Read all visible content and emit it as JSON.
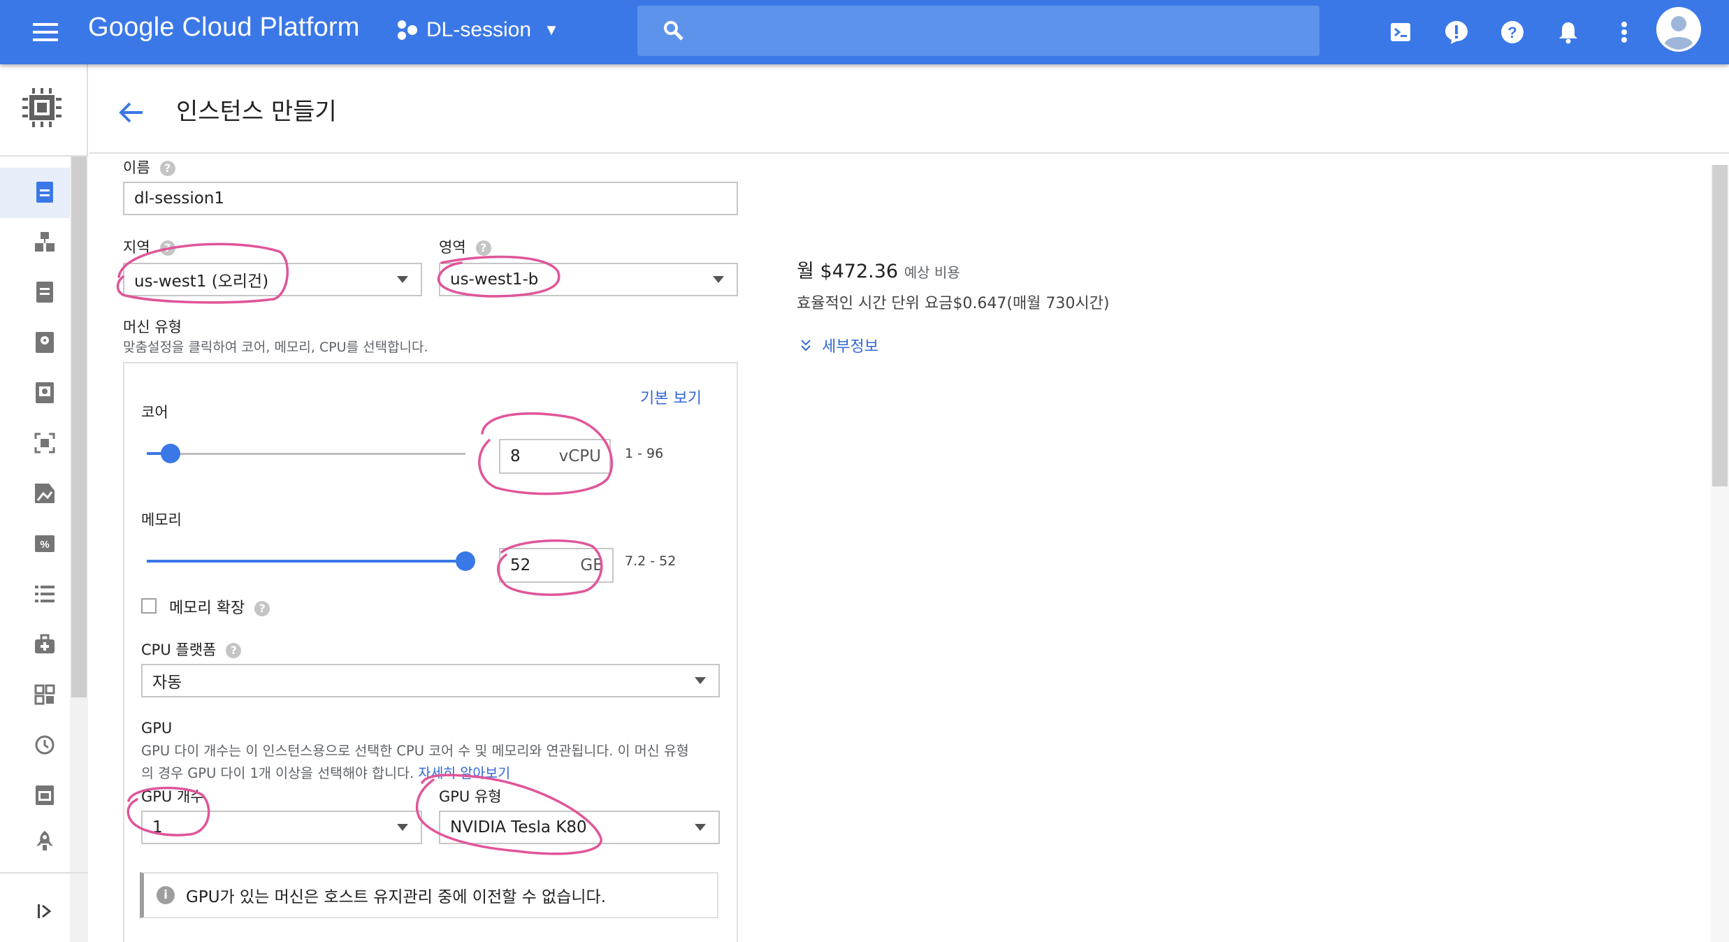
{
  "topbar": {
    "app_title": "Google Cloud Platform",
    "project_name": "DL-session",
    "icons": [
      "menu-icon",
      "search-icon",
      "cloud-shell-icon",
      "alert-icon",
      "help-icon",
      "notifications-icon",
      "more-vert-icon",
      "account-icon"
    ],
    "accent": "#3b78e7"
  },
  "rail": {
    "icons": [
      "compute-engine-icon",
      "vm-instances-icon",
      "instance-groups-icon",
      "instance-templates-icon",
      "disks-icon",
      "snapshots-icon",
      "images-icon",
      "tpus-icon",
      "committed-use-icon",
      "metadata-icon",
      "health-checks-icon",
      "zones-icon",
      "operations-icon",
      "security-scans-icon",
      "marketplace-icon",
      "collapse-icon"
    ]
  },
  "header": {
    "title": "인스턴스 만들기"
  },
  "form": {
    "name_label": "이름",
    "name_value": "dl-session1",
    "region_label": "지역",
    "region_value": "us-west1 (오리건)",
    "zone_label": "영역",
    "zone_value": "us-west1-b",
    "machine_type_label": "머신 유형",
    "machine_type_hint": "맞춤설정을 클릭하여 코어, 메모리, CPU를 선택합니다.",
    "basic_view_link": "기본 보기",
    "cores_label": "코어",
    "cores_value": "8",
    "cores_unit": "vCPU",
    "cores_range": "1 - 96",
    "cores_slider": {
      "min": 1,
      "max": 96,
      "value": 8
    },
    "memory_label": "메모리",
    "memory_value": "52",
    "memory_unit": "GB",
    "memory_range": "7.2 - 52",
    "memory_slider": {
      "min": 7.2,
      "max": 52,
      "value": 52
    },
    "extend_memory_label": "메모리 확장",
    "cpu_platform_label": "CPU 플랫폼",
    "cpu_platform_value": "자동",
    "gpu_title": "GPU",
    "gpu_desc_1": "GPU 다이 개수는 이 인스턴스용으로 선택한 CPU 코어 수 및 메모리와 연관됩니다. 이 머신 유형",
    "gpu_desc_2": "의 경우 GPU 다이 1개 이상을 선택해야 합니다.",
    "gpu_learn_more": "자세히 알아보기",
    "gpu_count_label": "GPU 개수",
    "gpu_count_value": "1",
    "gpu_type_label": "GPU 유형",
    "gpu_type_value": "NVIDIA Tesla K80",
    "gpu_notice": "GPU가 있는 머신은 호스트 유지관리 중에 이전할 수 없습니다."
  },
  "pricing": {
    "monthly_prefix": "월",
    "monthly_price": "$472.36",
    "monthly_suffix": "예상 비용",
    "hourly_text": "효율적인 시간 단위 요금$0.647(매월 730시간)",
    "details_link": "세부정보"
  },
  "annotation_color": "#e0559a"
}
